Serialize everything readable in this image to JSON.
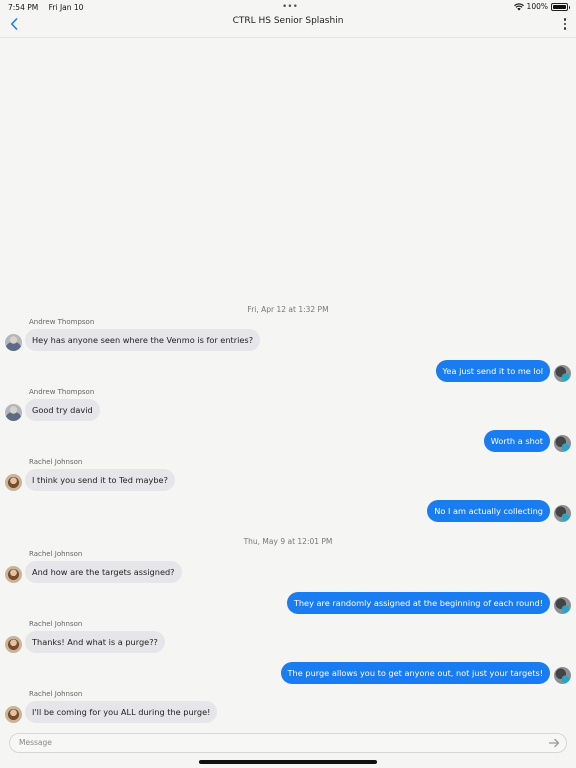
{
  "status_bar": {
    "time": "7:54 PM",
    "date": "Fri Jan 10",
    "dots": "•••",
    "battery_text": "100%",
    "battery_level": 1.0
  },
  "nav": {
    "title": "CTRL HS Senior Splashin"
  },
  "timestamps": [
    "Fri, Apr 12 at 1:32 PM",
    "Thu, May 9 at 12:01 PM"
  ],
  "messages": [
    {
      "sender": "Andrew Thompson",
      "text": "Hey has anyone seen where the Venmo is for entries?"
    },
    {
      "text": "Yea just send it to me lol"
    },
    {
      "sender": "Andrew Thompson",
      "text": "Good try david"
    },
    {
      "text": "Worth a shot"
    },
    {
      "sender": "Rachel Johnson",
      "text": "I think you send it to Ted maybe?"
    },
    {
      "text": "No I am actually collecting"
    },
    {
      "sender": "Rachel Johnson",
      "text": "And how are the targets assigned?"
    },
    {
      "text": "They are randomly assigned at the beginning of each round!"
    },
    {
      "sender": "Rachel Johnson",
      "text": "Thanks! And what is a purge??"
    },
    {
      "text": "The purge allows you to get anyone out, not just your targets!"
    },
    {
      "sender": "Rachel Johnson",
      "text": "I'll be coming for you ALL during the purge!"
    }
  ],
  "composer": {
    "placeholder": "Message"
  },
  "colors": {
    "outgoing_bubble": "#1a7cf1",
    "incoming_bubble": "#e6e6ea",
    "accent": "#1a7cf1",
    "background": "#f5f5f3"
  },
  "icons": {
    "back": "chevron-left-icon",
    "more": "vertical-ellipsis-icon",
    "send": "send-arrow-icon",
    "wifi": "wifi-icon",
    "battery": "battery-icon"
  }
}
